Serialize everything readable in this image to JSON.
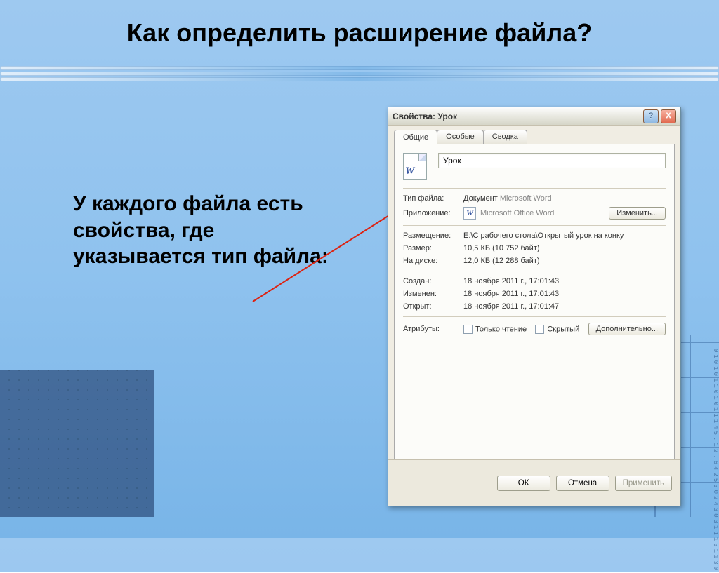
{
  "slide": {
    "title": "Как определить расширение файла?",
    "body": "У каждого файла есть свойства, где указывается тип файла:"
  },
  "dialog": {
    "title": "Свойства: Урок",
    "win": {
      "help": "?",
      "close": "X"
    },
    "tabs": [
      {
        "label": "Общие"
      },
      {
        "label": "Особые"
      },
      {
        "label": "Сводка"
      }
    ],
    "filename": "Урок",
    "rows": {
      "type": {
        "label": "Тип файла:",
        "value_prefix": "Документ ",
        "value_muted": "Microsoft Word"
      },
      "app": {
        "label": "Приложение:",
        "value": "Microsoft Office Word",
        "change_btn": "Изменить..."
      },
      "location": {
        "label": "Размещение:",
        "value": "E:\\С рабочего стола\\Открытый урок на конку"
      },
      "size": {
        "label": "Размер:",
        "value": "10,5 КБ (10 752 байт)"
      },
      "ondisk": {
        "label": "На диске:",
        "value": "12,0 КБ (12 288 байт)"
      },
      "created": {
        "label": "Создан:",
        "value": "18 ноября 2011 г., 17:01:43"
      },
      "modified": {
        "label": "Изменен:",
        "value": "18 ноября 2011 г., 17:01:43"
      },
      "opened": {
        "label": "Открыт:",
        "value": "18 ноября 2011 г., 17:01:47"
      },
      "attrs": {
        "label": "Атрибуты:",
        "readonly": "Только чтение",
        "hidden": "Скрытый",
        "advanced": "Дополнительно..."
      }
    },
    "footer": {
      "ok": "ОК",
      "cancel": "Отмена",
      "apply": "Применить"
    }
  },
  "deco": {
    "digits": "010101101011145.12.6425302430311131130"
  }
}
